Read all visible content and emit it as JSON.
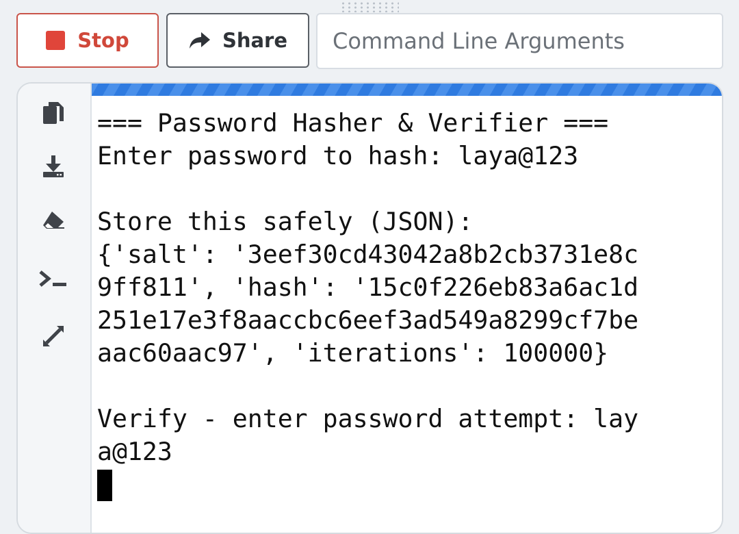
{
  "toolbar": {
    "stop_label": "Stop",
    "share_label": "Share",
    "args_placeholder": "Command Line Arguments",
    "args_value": ""
  },
  "colors": {
    "stop_accent": "#e0453a",
    "progress_blue": "#2f7be0"
  },
  "side_tools": [
    {
      "icon": "copy-icon"
    },
    {
      "icon": "download-icon"
    },
    {
      "icon": "eraser-icon"
    },
    {
      "icon": "terminal-icon"
    },
    {
      "icon": "expand-icon"
    }
  ],
  "console": {
    "lines": [
      "=== Password Hasher & Verifier ===",
      "Enter password to hash: laya@123",
      "",
      "Store this safely (JSON):",
      "{'salt': '3eef30cd43042a8b2cb3731e8c",
      "9ff811', 'hash': '15c0f226eb83a6ac1d",
      "251e17e3f8aaccbc6eef3ad549a8299cf7be",
      "aac60aac97', 'iterations': 100000}",
      "",
      "Verify - enter password attempt: lay",
      "a@123"
    ]
  }
}
